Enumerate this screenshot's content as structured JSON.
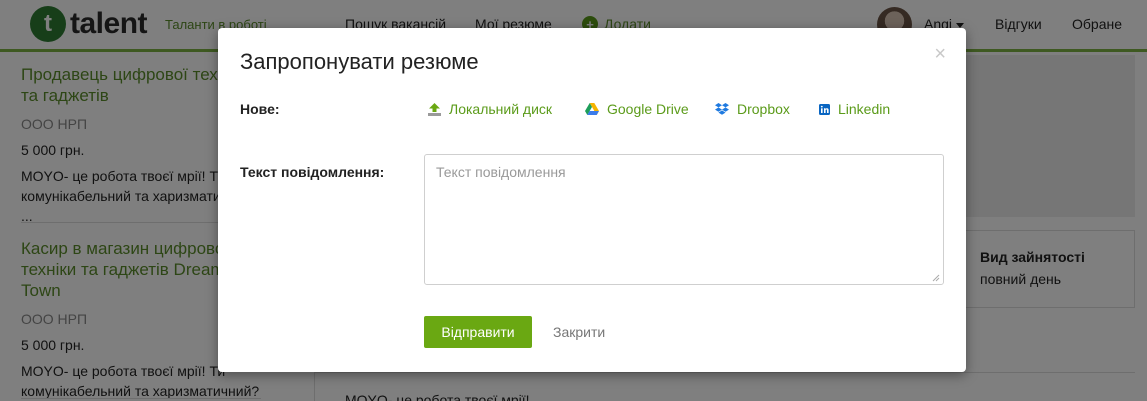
{
  "header": {
    "logo_mark": "t",
    "logo_text": "talent",
    "tagline": "Таланти в роботі",
    "nav": [
      "Пошук вакансій",
      "Мої резюме"
    ],
    "add_label": "Додати",
    "user_name": "Angi",
    "reviews": "Відгуки",
    "favorites": "Обране",
    "accent_color": "#7cb342"
  },
  "listings": [
    {
      "title": "Продавець цифрової техніки та гаджетів",
      "company": "ООО НРП",
      "salary": "5 000 грн.",
      "description": "MOYO- це робота твоєї мрії! Ти комунікабельний та харизматичний? ..."
    },
    {
      "title": "Касир в магазин цифрової техніки та гаджетів Dream Town",
      "company": "ООО НРП",
      "salary": "5 000 грн.",
      "description": "MOYO- це робота твоєї мрії! Ти комунікабельний та харизматичний? ..."
    }
  ],
  "employment": {
    "label": "Вид зайнятості",
    "value": "повний день"
  },
  "bottom_description": "MOYO- це робота твоєї мрії!",
  "modal": {
    "title": "Запропонувати резюме",
    "close_symbol": "×",
    "new_label": "Нове:",
    "upload_options": [
      {
        "label": "Локальний диск",
        "icon": "upload-icon"
      },
      {
        "label": "Google Drive",
        "icon": "google-drive-icon"
      },
      {
        "label": "Dropbox",
        "icon": "dropbox-icon"
      },
      {
        "label": "Linkedin",
        "icon": "linkedin-icon"
      }
    ],
    "message_label": "Текст повідомлення:",
    "message_value": "",
    "message_placeholder": "Текст повідомлення",
    "send_label": "Відправити",
    "close_label": "Закрити",
    "send_color": "#6aa812"
  }
}
